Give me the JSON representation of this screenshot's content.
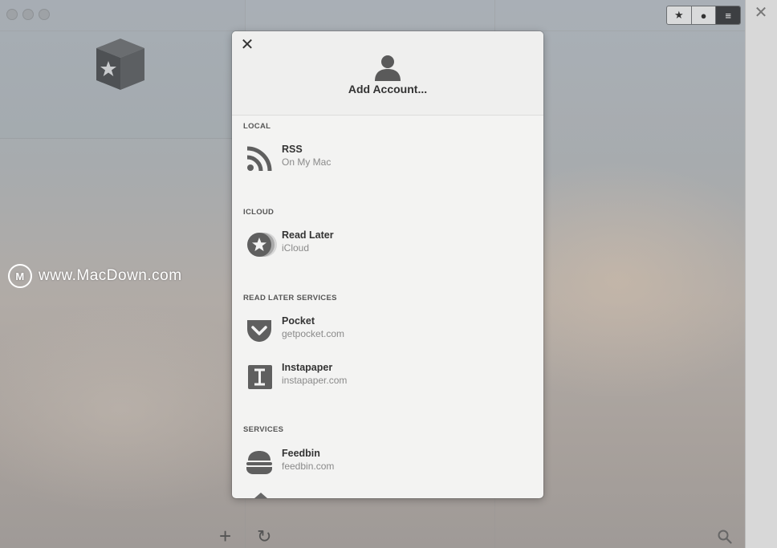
{
  "toolbar": {
    "segments": [
      "★",
      "●",
      "≡"
    ]
  },
  "watermark": {
    "text": "www.MacDown.com",
    "icon_glyph": "M"
  },
  "modal": {
    "close_glyph": "✕",
    "title": "Add Account...",
    "sections": [
      {
        "title": "LOCAL",
        "items": [
          {
            "name": "RSS",
            "sub": "On My Mac",
            "icon": "rss-icon"
          }
        ]
      },
      {
        "title": "ICLOUD",
        "items": [
          {
            "name": "Read Later",
            "sub": "iCloud",
            "icon": "read-later-star-icon"
          }
        ]
      },
      {
        "title": "READ LATER SERVICES",
        "items": [
          {
            "name": "Pocket",
            "sub": "getpocket.com",
            "icon": "pocket-icon"
          },
          {
            "name": "Instapaper",
            "sub": "instapaper.com",
            "icon": "instapaper-icon"
          }
        ]
      },
      {
        "title": "SERVICES",
        "items": [
          {
            "name": "Feedbin",
            "sub": "feedbin.com",
            "icon": "feedbin-icon"
          }
        ]
      }
    ]
  },
  "bottom_bar": {
    "add_glyph": "+",
    "refresh_glyph": "↻"
  },
  "rail": {
    "close_glyph": "✕"
  },
  "colors": {
    "modal_bg": "#f3f3f2",
    "icon_gray": "#5f5f5f",
    "dark_segment": "#3d3f42"
  }
}
